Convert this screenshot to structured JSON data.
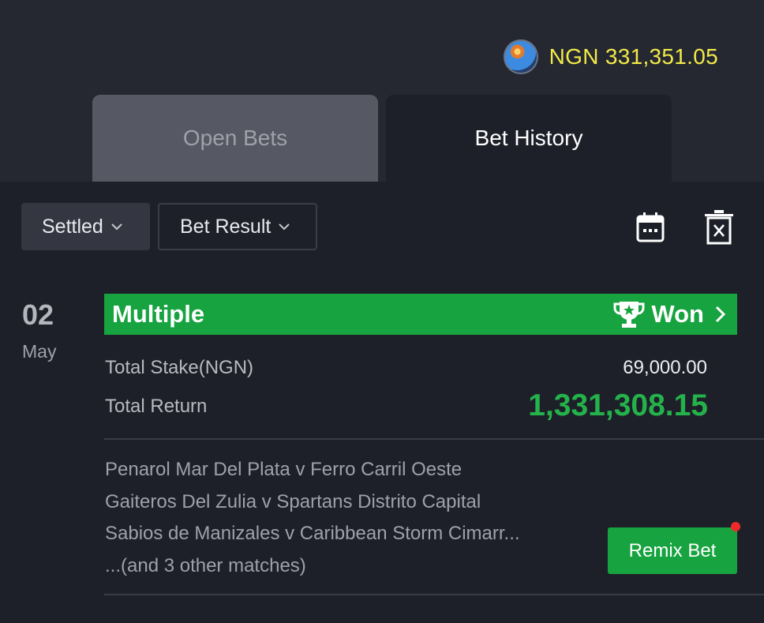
{
  "header": {
    "balance": "NGN 331,351.05",
    "coin_icon": "coin-avatar-icon"
  },
  "tabs": [
    {
      "label": "Open Bets",
      "active": false
    },
    {
      "label": "Bet History",
      "active": true
    }
  ],
  "filters": {
    "status": "Settled",
    "result": "Bet Result"
  },
  "toolbar_icons": [
    "calendar-icon",
    "trash-icon"
  ],
  "bet": {
    "date_day": "02",
    "date_month": "May",
    "type": "Multiple",
    "result": "Won",
    "stake_label": "Total Stake(NGN)",
    "stake_value": "69,000.00",
    "return_label": "Total Return",
    "return_value": "1,331,308.15",
    "matches": [
      "Penarol Mar Del Plata v Ferro Carril Oeste",
      "Gaiteros Del Zulia v Spartans Distrito Capital",
      "Sabios de Manizales v Caribbean Storm Cimarr...",
      "...(and 3 other matches)"
    ],
    "remix_label": "Remix Bet"
  },
  "colors": {
    "accent_green": "#17a33f",
    "return_green": "#24b24b",
    "balance_yellow": "#f2e94a",
    "notification_red": "#ee2a2a"
  }
}
